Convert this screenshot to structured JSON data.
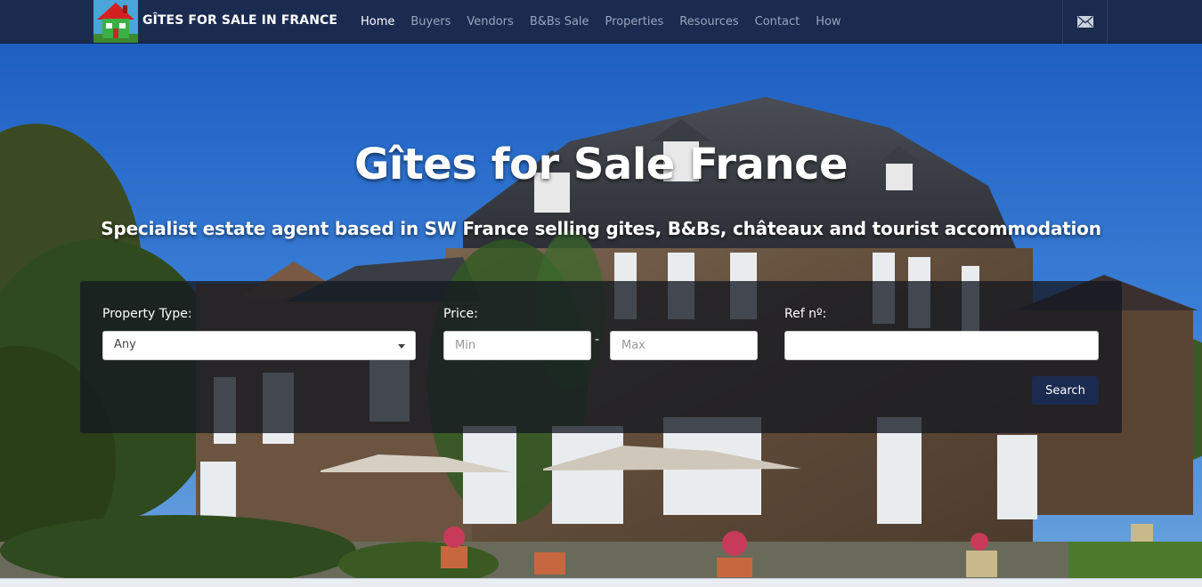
{
  "brand": {
    "name": "GÎTES FOR SALE IN FRANCE",
    "logo_icon": "house-logo-icon"
  },
  "nav": {
    "items": [
      {
        "label": "Home",
        "active": true
      },
      {
        "label": "Buyers"
      },
      {
        "label": "Vendors"
      },
      {
        "label": "B&Bs Sale"
      },
      {
        "label": "Properties"
      },
      {
        "label": "Resources"
      },
      {
        "label": "Contact"
      },
      {
        "label": "How"
      }
    ],
    "mail_icon": "envelope-icon"
  },
  "hero": {
    "title": "Gîtes for Sale France",
    "subtitle": "Specialist estate agent based in SW France selling gites, B&Bs, châteaux and tourist accommodation"
  },
  "search": {
    "property_type_label": "Property Type:",
    "property_type_value": "Any",
    "price_label": "Price:",
    "price_min_placeholder": "Min",
    "price_separator": "-",
    "price_max_placeholder": "Max",
    "ref_label": "Ref nº:",
    "ref_value": "",
    "button_label": "Search"
  },
  "colors": {
    "navbar": "#1b2a4f",
    "accent": "#1b2a4f",
    "sky": "#2f6fc9"
  }
}
